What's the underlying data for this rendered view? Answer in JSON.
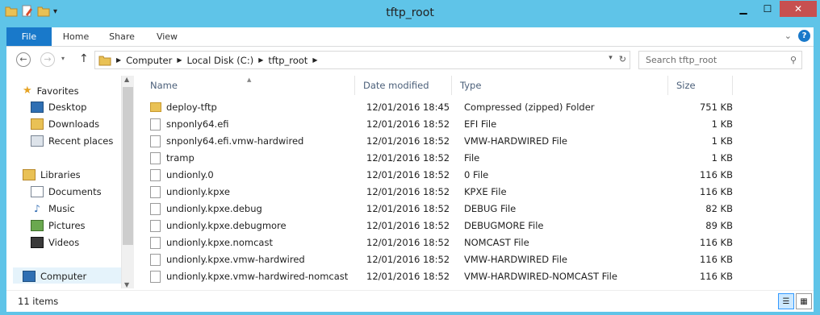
{
  "window": {
    "title": "tftp_root",
    "buttons": {
      "minimize": "▁",
      "maximize": "☐",
      "close": "✕"
    }
  },
  "ribbon": {
    "tabs": [
      "File",
      "Home",
      "Share",
      "View"
    ],
    "expand": "⌄",
    "help": "?"
  },
  "nav": {
    "back": "←",
    "forward": "→",
    "up": "↑",
    "breadcrumb": [
      "Computer",
      "Local Disk (C:)",
      "tftp_root"
    ],
    "search_placeholder": "Search tftp_root"
  },
  "sidebar": {
    "favorites": "Favorites",
    "desktop": "Desktop",
    "downloads": "Downloads",
    "recent": "Recent places",
    "libraries": "Libraries",
    "documents": "Documents",
    "music": "Music",
    "pictures": "Pictures",
    "videos": "Videos",
    "computer": "Computer"
  },
  "columns": {
    "name": "Name",
    "date": "Date modified",
    "type": "Type",
    "size": "Size"
  },
  "files": [
    {
      "name": "deploy-tftp",
      "date": "12/01/2016 18:45",
      "type": "Compressed (zipped) Folder",
      "size": "751 KB",
      "icon": "zip-folder"
    },
    {
      "name": "snponly64.efi",
      "date": "12/01/2016 18:52",
      "type": "EFI File",
      "size": "1 KB",
      "icon": "file"
    },
    {
      "name": "snponly64.efi.vmw-hardwired",
      "date": "12/01/2016 18:52",
      "type": "VMW-HARDWIRED File",
      "size": "1 KB",
      "icon": "file"
    },
    {
      "name": "tramp",
      "date": "12/01/2016 18:52",
      "type": "File",
      "size": "1 KB",
      "icon": "file"
    },
    {
      "name": "undionly.0",
      "date": "12/01/2016 18:52",
      "type": "0 File",
      "size": "116 KB",
      "icon": "file"
    },
    {
      "name": "undionly.kpxe",
      "date": "12/01/2016 18:52",
      "type": "KPXE File",
      "size": "116 KB",
      "icon": "file"
    },
    {
      "name": "undionly.kpxe.debug",
      "date": "12/01/2016 18:52",
      "type": "DEBUG File",
      "size": "82 KB",
      "icon": "file"
    },
    {
      "name": "undionly.kpxe.debugmore",
      "date": "12/01/2016 18:52",
      "type": "DEBUGMORE File",
      "size": "89 KB",
      "icon": "file"
    },
    {
      "name": "undionly.kpxe.nomcast",
      "date": "12/01/2016 18:52",
      "type": "NOMCAST File",
      "size": "116 KB",
      "icon": "file"
    },
    {
      "name": "undionly.kpxe.vmw-hardwired",
      "date": "12/01/2016 18:52",
      "type": "VMW-HARDWIRED File",
      "size": "116 KB",
      "icon": "file"
    },
    {
      "name": "undionly.kpxe.vmw-hardwired-nomcast",
      "date": "12/01/2016 18:52",
      "type": "VMW-HARDWIRED-NOMCAST File",
      "size": "116 KB",
      "icon": "file"
    }
  ],
  "status": {
    "count": "11 items"
  }
}
